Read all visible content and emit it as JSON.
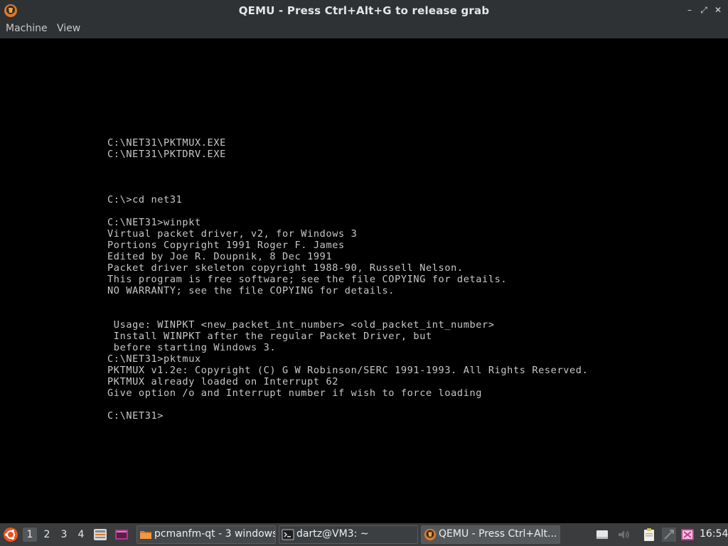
{
  "window": {
    "title": "QEMU - Press Ctrl+Alt+G to release grab",
    "icon": "qemu-icon",
    "buttons": {
      "minimize": "–",
      "maximize": "⤢",
      "close": "✕"
    }
  },
  "menubar": {
    "machine": "Machine",
    "view": "View"
  },
  "console": {
    "lines": [
      "C:\\NET31\\PKTMUX.EXE",
      "C:\\NET31\\PKTDRV.EXE",
      "",
      "",
      "",
      "C:\\>cd net31",
      "",
      "C:\\NET31>winpkt",
      "Virtual packet driver, v2, for Windows 3",
      "Portions Copyright 1991 Roger F. James",
      "Edited by Joe R. Doupnik, 8 Dec 1991",
      "Packet driver skeleton copyright 1988-90, Russell Nelson.",
      "This program is free software; see the file COPYING for details.",
      "NO WARRANTY; see the file COPYING for details.",
      "",
      "",
      " Usage: WINPKT <new_packet_int_number> <old_packet_int_number>",
      " Install WINPKT after the regular Packet Driver, but",
      " before starting Windows 3.",
      "C:\\NET31>pktmux",
      "PKTMUX v1.2e: Copyright (C) G W Robinson/SERC 1991-1993. All Rights Reserved.",
      "PKTMUX already loaded on Interrupt 62",
      "Give option /o and Interrupt number if wish to force loading",
      "",
      "C:\\NET31>"
    ]
  },
  "taskbar": {
    "start_icon": "ubuntu-logo-icon",
    "desktops": [
      "1",
      "2",
      "3",
      "4"
    ],
    "active_desktop": "1",
    "tasks": {
      "pcmanfm": "pcmanfm-qt - 3 windows",
      "terminal": "dartz@VM3: ~",
      "qemu": "QEMU - Press Ctrl+Alt..."
    },
    "clock": "16:54"
  },
  "colors": {
    "titlebar": "#2f3234",
    "taskbar": "#3a3c3e",
    "console_text": "#c8c8c8",
    "ubuntu_orange": "#e95420"
  }
}
